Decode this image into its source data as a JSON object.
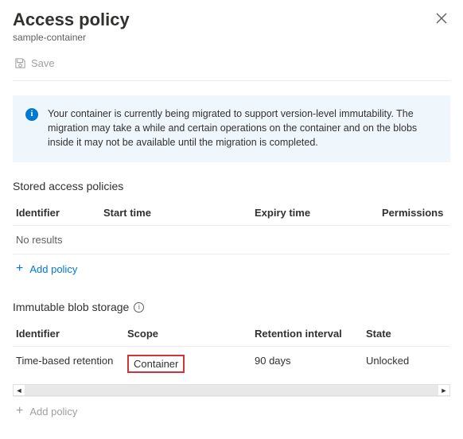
{
  "header": {
    "title": "Access policy",
    "subtitle": "sample-container"
  },
  "toolbar": {
    "save_label": "Save"
  },
  "info": {
    "message": "Your container is currently being migrated to support version-level immutability. The migration may take a while and certain operations on the container and on the blobs inside it may not be available until the migration is completed."
  },
  "stored_policies": {
    "title": "Stored access policies",
    "columns": {
      "identifier": "Identifier",
      "start": "Start time",
      "expiry": "Expiry time",
      "permissions": "Permissions"
    },
    "empty": "No results",
    "add_label": "Add policy"
  },
  "immutable": {
    "title": "Immutable blob storage",
    "columns": {
      "identifier": "Identifier",
      "scope": "Scope",
      "retention": "Retention interval",
      "state": "State"
    },
    "rows": [
      {
        "identifier": "Time-based retention",
        "scope": "Container",
        "retention": "90 days",
        "state": "Unlocked"
      }
    ],
    "add_label": "Add policy"
  }
}
